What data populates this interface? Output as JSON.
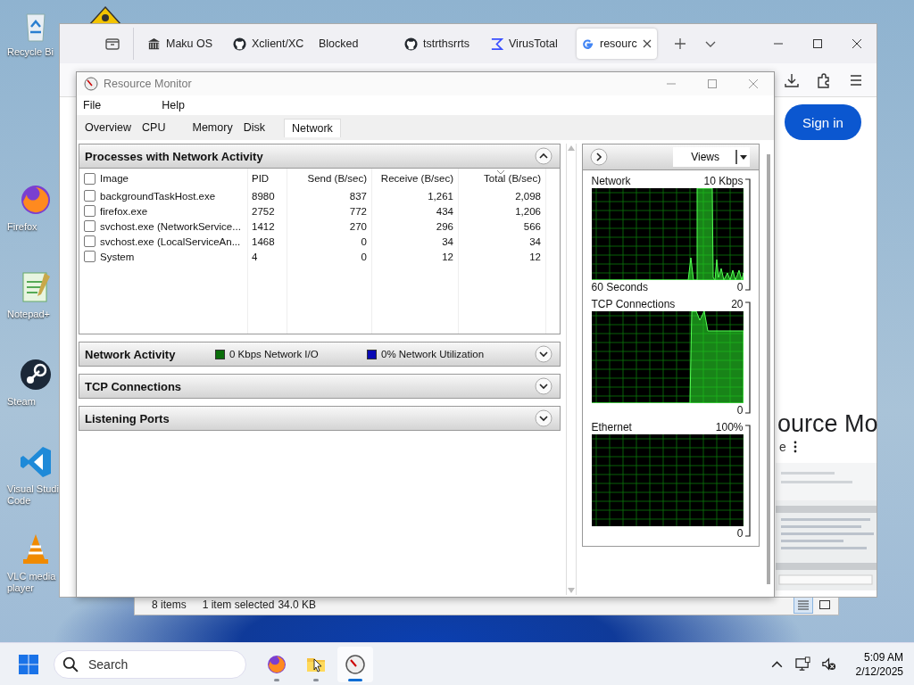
{
  "desktop": {
    "icons": [
      {
        "kind": "recycle",
        "lines": [
          "Recycle Bi"
        ]
      },
      {
        "kind": "firefox",
        "lines": [
          "Firefox"
        ]
      },
      {
        "kind": "notepad",
        "lines": [
          "Notepad+"
        ]
      },
      {
        "kind": "steam",
        "lines": [
          "Steam"
        ]
      },
      {
        "kind": "vscode",
        "lines": [
          "Visual Studi",
          "Code"
        ]
      },
      {
        "kind": "vlc",
        "lines": [
          "VLC media",
          "player"
        ]
      }
    ]
  },
  "browser": {
    "tabs": [
      {
        "kind": "building",
        "label": "Maku OS",
        "selected": false
      },
      {
        "kind": "github",
        "label": "Xclient/XC",
        "selected": false
      },
      {
        "kind": "none",
        "label": "Blocked",
        "selected": false
      },
      {
        "kind": "github",
        "label": "tstrthsrrts",
        "selected": false
      },
      {
        "kind": "sigma",
        "label": "VirusTotal",
        "selected": false
      },
      {
        "kind": "google",
        "label": "resourc",
        "selected": true
      }
    ],
    "sign_in": "Sign in",
    "heading": "ource Mo",
    "subtitle": "e"
  },
  "explorer_status": {
    "items": "8 items",
    "selection": "1 item selected",
    "size": "34.0 KB",
    "views": [
      {
        "kind": "details",
        "selected": true
      },
      {
        "kind": "tiles",
        "selected": false
      }
    ]
  },
  "resource_monitor": {
    "title": "Resource Monitor",
    "menu": [
      "File",
      "Help"
    ],
    "tabs": [
      {
        "label": "Overview",
        "selected": false
      },
      {
        "label": "CPU",
        "selected": false
      },
      {
        "label": "Memory",
        "selected": false
      },
      {
        "label": "Disk",
        "selected": false
      },
      {
        "label": "Network",
        "selected": true
      }
    ],
    "processes": {
      "title": "Processes with Network Activity",
      "expanded": true,
      "all_checked": false,
      "columns": [
        {
          "label": "Image"
        },
        {
          "label": "PID"
        },
        {
          "label": "Send (B/sec)"
        },
        {
          "label": "Receive (B/sec)"
        },
        {
          "label": "Total (B/sec)",
          "sorted": true
        }
      ],
      "rows": [
        {
          "checked": false,
          "cells": [
            "backgroundTaskHost.exe",
            "8980",
            "837",
            "1,261",
            "2,098"
          ]
        },
        {
          "checked": false,
          "cells": [
            "firefox.exe",
            "2752",
            "772",
            "434",
            "1,206"
          ]
        },
        {
          "checked": false,
          "cells": [
            "svchost.exe (NetworkService...",
            "1412",
            "270",
            "296",
            "566"
          ]
        },
        {
          "checked": false,
          "cells": [
            "svchost.exe (LocalServiceAn...",
            "1468",
            "0",
            "34",
            "34"
          ]
        },
        {
          "checked": false,
          "cells": [
            "System",
            "4",
            "0",
            "12",
            "12"
          ]
        }
      ]
    },
    "sections": [
      {
        "title": "Network Activity",
        "expanded": false,
        "legend": [
          {
            "label": "0 Kbps Network I/O",
            "color": "#0a6e0a"
          },
          {
            "label": "0% Network Utilization",
            "color": "#0a0ab4"
          }
        ]
      },
      {
        "title": "TCP Connections",
        "expanded": false
      },
      {
        "title": "Listening Ports",
        "expanded": false
      }
    ],
    "views_button": "Views",
    "graphs": [
      {
        "kind": "network",
        "title": "Network",
        "max": "10 Kbps",
        "time": "60 Seconds",
        "min": "0"
      },
      {
        "kind": "tcp",
        "title": "TCP Connections",
        "max": "20",
        "min": "0"
      },
      {
        "kind": "ethernet",
        "title": "Ethernet",
        "max": "100%",
        "min": "0"
      }
    ]
  },
  "taskbar": {
    "search_placeholder": "Search",
    "apps": [
      {
        "kind": "firefox",
        "selected": false
      },
      {
        "kind": "explorer",
        "selected": false
      },
      {
        "kind": "resmon",
        "selected": true
      }
    ],
    "time": "5:09 AM",
    "date": "2/12/2025"
  }
}
